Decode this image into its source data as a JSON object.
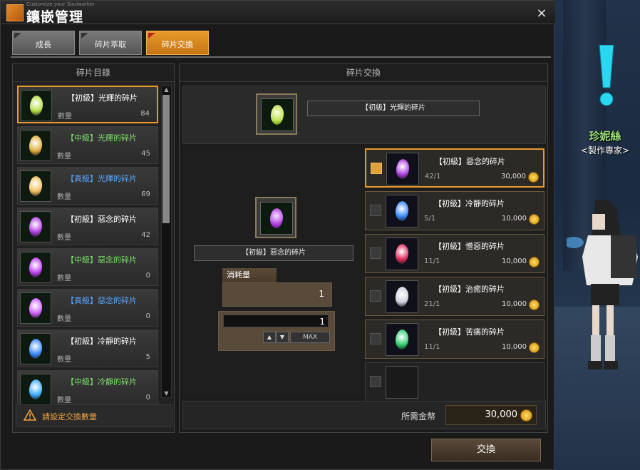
{
  "window": {
    "title": "鑲嵌管理",
    "subtitle": "Customize your Soulworker",
    "close": "×"
  },
  "tabs": [
    {
      "label": "成長",
      "active": false
    },
    {
      "label": "碎片萃取",
      "active": false
    },
    {
      "label": "碎片交換",
      "active": true
    }
  ],
  "left": {
    "header": "碎片目錄",
    "qty_label": "數量",
    "items": [
      {
        "name": "【初級】光輝的碎片",
        "qty": "84",
        "color": "#ffffff",
        "gem": "#b8e04a",
        "selected": true
      },
      {
        "name": "【中級】光輝的碎片",
        "qty": "45",
        "color": "#7ee06a",
        "gem": "#e0b040",
        "selected": false
      },
      {
        "name": "【高級】光輝的碎片",
        "qty": "69",
        "color": "#5aa8ff",
        "gem": "#f0c060",
        "selected": false
      },
      {
        "name": "【初級】惡念的碎片",
        "qty": "42",
        "color": "#ffffff",
        "gem": "#b040e0",
        "selected": false
      },
      {
        "name": "【中級】惡念的碎片",
        "qty": "0",
        "color": "#7ee06a",
        "gem": "#c040f0",
        "selected": false
      },
      {
        "name": "【高級】惡念的碎片",
        "qty": "0",
        "color": "#5aa8ff",
        "gem": "#d060ff",
        "selected": false
      },
      {
        "name": "【初級】冷靜的碎片",
        "qty": "5",
        "color": "#ffffff",
        "gem": "#3a8aff",
        "selected": false
      },
      {
        "name": "【中級】冷靜的碎片",
        "qty": "0",
        "color": "#7ee06a",
        "gem": "#40b0ff",
        "selected": false
      }
    ],
    "warning": "請設定交換數量"
  },
  "right": {
    "header": "碎片交換",
    "source_name": "【初級】光輝的碎片",
    "target_name": "【初級】惡念的碎片",
    "consume_label": "消耗量",
    "consume_value": "1",
    "input_value": "1",
    "max_label": "MAX",
    "targets": [
      {
        "name": "【初級】惡念的碎片",
        "ratio": "42/1",
        "cost": "30,000",
        "gem": "#b040e0",
        "selected": true
      },
      {
        "name": "【初級】冷靜的碎片",
        "ratio": "5/1",
        "cost": "10,000",
        "gem": "#3a8aff",
        "selected": false
      },
      {
        "name": "【初級】憎惡的碎片",
        "ratio": "11/1",
        "cost": "10,000",
        "gem": "#e03060",
        "selected": false
      },
      {
        "name": "【初級】治癒的碎片",
        "ratio": "21/1",
        "cost": "10,000",
        "gem": "#d0d0e0",
        "selected": false
      },
      {
        "name": "【初級】苦痛的碎片",
        "ratio": "11/1",
        "cost": "10,000",
        "gem": "#30d070",
        "selected": false
      }
    ],
    "gold_label": "所需金幣",
    "gold_value": "30,000"
  },
  "exchange_button": "交換",
  "npc": {
    "name": "珍妮絲",
    "title": "<製作專家>"
  }
}
